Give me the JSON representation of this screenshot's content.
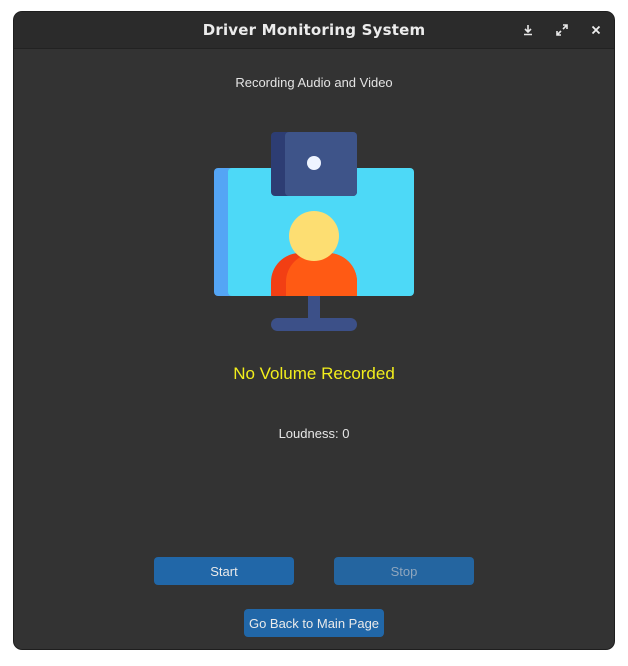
{
  "window": {
    "title": "Driver Monitoring System",
    "controls": {
      "minimize_icon": "download-arrow-icon",
      "maximize_icon": "expand-arrows-icon",
      "close_icon": "close-icon"
    }
  },
  "main": {
    "subtitle": "Recording Audio and Video",
    "illustration_icon": "webcam-monitor-person-icon",
    "volume_status": "No Volume Recorded",
    "loudness_label": "Loudness:",
    "loudness_value": "0"
  },
  "buttons": {
    "start_label": "Start",
    "stop_label": "Stop",
    "stop_enabled": false,
    "back_label": "Go Back to Main Page"
  },
  "colors": {
    "background": "#333333",
    "titlebar": "#2b2b2b",
    "status_text": "#f2ee1c",
    "button": "#2167a8"
  }
}
